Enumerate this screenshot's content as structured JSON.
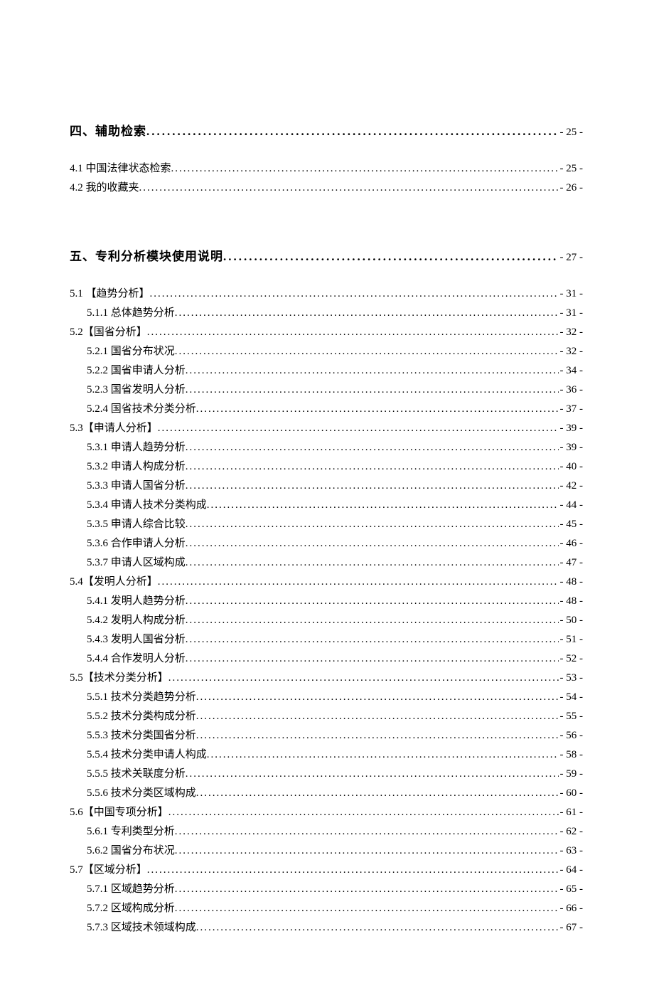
{
  "toc": [
    {
      "level": 0,
      "label": "四、辅助检索",
      "page": "- 25 -"
    },
    {
      "level": 1,
      "label": "4.1 中国法律状态检索 ",
      "page": "- 25 -"
    },
    {
      "level": 1,
      "label": "4.2 我的收藏夹 ",
      "page": "- 26 -"
    },
    {
      "gap": true
    },
    {
      "level": 0,
      "label": "五、专利分析模块使用说明",
      "page": "- 27 -"
    },
    {
      "level": 1,
      "label": "5.1 【趋势分析】 ",
      "page": "- 31 -"
    },
    {
      "level": 2,
      "label": "5.1.1 总体趋势分析 ",
      "page": "- 31 -"
    },
    {
      "level": 1,
      "label": "5.2【国省分析】 ",
      "page": "- 32 -"
    },
    {
      "level": 2,
      "label": "5.2.1 国省分布状况",
      "page": "- 32 -"
    },
    {
      "level": 2,
      "label": "5.2.2 国省申请人分析 ",
      "page": "- 34 -"
    },
    {
      "level": 2,
      "label": "5.2.3 国省发明人分析 ",
      "page": "- 36 -"
    },
    {
      "level": 2,
      "label": "5.2.4 国省技术分类分析 ",
      "page": "- 37 -"
    },
    {
      "level": 1,
      "label": "5.3【申请人分析】 ",
      "page": "- 39 -"
    },
    {
      "level": 2,
      "label": "5.3.1 申请人趋势分析 ",
      "page": "- 39 -"
    },
    {
      "level": 2,
      "label": "5.3.2 申请人构成分析 ",
      "page": "- 40 -"
    },
    {
      "level": 2,
      "label": "5.3.3 申请人国省分析 ",
      "page": "- 42 -"
    },
    {
      "level": 2,
      "label": "5.3.4 申请人技术分类构成 ",
      "page": "- 44 -"
    },
    {
      "level": 2,
      "label": "5.3.5 申请人综合比较 ",
      "page": "- 45 -"
    },
    {
      "level": 2,
      "label": "5.3.6 合作申请人分析 ",
      "page": "- 46 -"
    },
    {
      "level": 2,
      "label": "5.3.7 申请人区域构成 ",
      "page": "- 47 -"
    },
    {
      "level": 1,
      "label": "5.4【发明人分析】 ",
      "page": "- 48 -"
    },
    {
      "level": 2,
      "label": "5.4.1 发明人趋势分析 ",
      "page": "- 48 -"
    },
    {
      "level": 2,
      "label": "5.4.2 发明人构成分析 ",
      "page": "- 50 -"
    },
    {
      "level": 2,
      "label": "5.4.3 发明人国省分析 ",
      "page": "- 51 -"
    },
    {
      "level": 2,
      "label": "5.4.4 合作发明人分析 ",
      "page": "- 52 -"
    },
    {
      "level": 1,
      "label": "5.5【技术分类分析】 ",
      "page": "- 53 -"
    },
    {
      "level": 2,
      "label": "5.5.1 技术分类趋势分析 ",
      "page": "- 54 -"
    },
    {
      "level": 2,
      "label": "5.5.2 技术分类构成分析 ",
      "page": "- 55 -"
    },
    {
      "level": 2,
      "label": "5.5.3 技术分类国省分析 ",
      "page": "- 56 -"
    },
    {
      "level": 2,
      "label": "5.5.4 技术分类申请人构成 ",
      "page": "- 58 -"
    },
    {
      "level": 2,
      "label": "5.5.5 技术关联度分析 ",
      "page": "- 59 -"
    },
    {
      "level": 2,
      "label": "5.5.6 技术分类区域构成 ",
      "page": "- 60 -"
    },
    {
      "level": 1,
      "label": "5.6【中国专项分析】 ",
      "page": "- 61 -"
    },
    {
      "level": 2,
      "label": "5.6.1 专利类型分析 ",
      "page": "- 62 -"
    },
    {
      "level": 2,
      "label": "5.6.2 国省分布状况 ",
      "page": "- 63 -"
    },
    {
      "level": 1,
      "label": "5.7【区域分析】 ",
      "page": "- 64 -"
    },
    {
      "level": 2,
      "label": "5.7.1 区域趋势分析",
      "page": "- 65 -"
    },
    {
      "level": 2,
      "label": "5.7.2 区域构成分析",
      "page": "- 66 -"
    },
    {
      "level": 2,
      "label": "5.7.3 区域技术领域构成",
      "page": "- 67 -"
    }
  ]
}
